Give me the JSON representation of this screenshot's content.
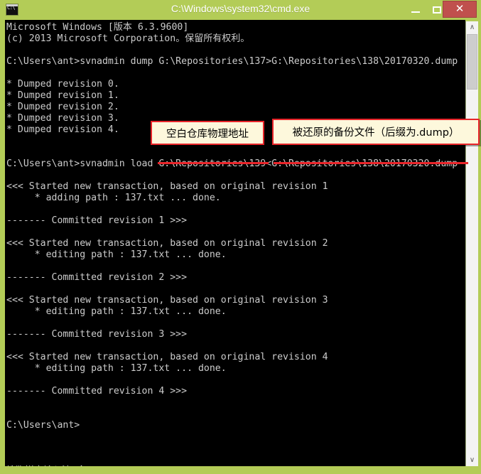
{
  "window": {
    "title": "C:\\Windows\\system32\\cmd.exe",
    "icon_name": "cmd-console-icon",
    "icon_text": "C:\\",
    "titlebar_color": "#b3cc57",
    "close_button_color": "#c0504d",
    "controls": {
      "minimize_label": "",
      "maximize_label": "",
      "close_label": "✕"
    }
  },
  "console": {
    "background": "#000000",
    "foreground": "#cccccc",
    "lines": [
      "Microsoft Windows [版本 6.3.9600]",
      "(c) 2013 Microsoft Corporation。保留所有权利。",
      "",
      "C:\\Users\\ant>svnadmin dump G:\\Repositories\\137>G:\\Repositories\\138\\20170320.dump",
      "",
      "* Dumped revision 0.",
      "* Dumped revision 1.",
      "* Dumped revision 2.",
      "* Dumped revision 3.",
      "* Dumped revision 4.",
      "",
      "",
      "C:\\Users\\ant>svnadmin load G:\\Repositories\\139<G:\\Repositories\\138\\20170320.dump",
      "",
      "<<< Started new transaction, based on original revision 1",
      "     * adding path : 137.txt ... done.",
      "",
      "------- Committed revision 1 >>>",
      "",
      "<<< Started new transaction, based on original revision 2",
      "     * editing path : 137.txt ... done.",
      "",
      "------- Committed revision 2 >>>",
      "",
      "<<< Started new transaction, based on original revision 3",
      "     * editing path : 137.txt ... done.",
      "",
      "------- Committed revision 3 >>>",
      "",
      "<<< Started new transaction, based on original revision 4",
      "     * editing path : 137.txt ... done.",
      "",
      "------- Committed revision 4 >>>",
      "",
      "",
      "C:\\Users\\ant>",
      "",
      "",
      "",
      "搜狗拼音输入法 全 ："
    ]
  },
  "scrollbar": {
    "up_arrow": "∧",
    "down_arrow": "∨"
  },
  "annotations": {
    "callout_1": "空白仓库物理地址",
    "callout_2": "被还原的备份文件（后缀为.dump）",
    "highlight_color": "#e8252a",
    "callout_background": "#fdf8dc"
  }
}
